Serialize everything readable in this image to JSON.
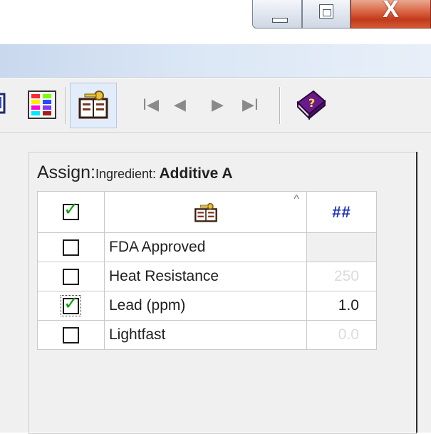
{
  "window": {
    "minimize_icon": "minimize-icon",
    "maximize_icon": "maximize-icon",
    "close_glyph": "X",
    "close_color": "#c23a1c"
  },
  "toolbar": {
    "icons": [
      "partial-toolbar-icon",
      "color-palette-icon",
      "key-book-icon",
      "first-record-icon",
      "previous-record-icon",
      "next-record-icon",
      "last-record-icon",
      "help-book-icon"
    ],
    "nav": {
      "first": "I◀",
      "prev": "◀",
      "next": "▶",
      "last": "▶I"
    }
  },
  "assign": {
    "label": "Assign:",
    "context": "Ingredient:",
    "value": "Additive A"
  },
  "grid": {
    "header_value": "##",
    "sort_caret": "^",
    "rows": [
      {
        "checked": false,
        "property": "FDA Approved",
        "value": ""
      },
      {
        "checked": false,
        "property": "Heat Resistance",
        "value": "250"
      },
      {
        "checked": true,
        "property": "Lead (ppm)",
        "value": "1.0"
      },
      {
        "checked": false,
        "property": "Lightfast",
        "value": "0.0"
      }
    ]
  }
}
